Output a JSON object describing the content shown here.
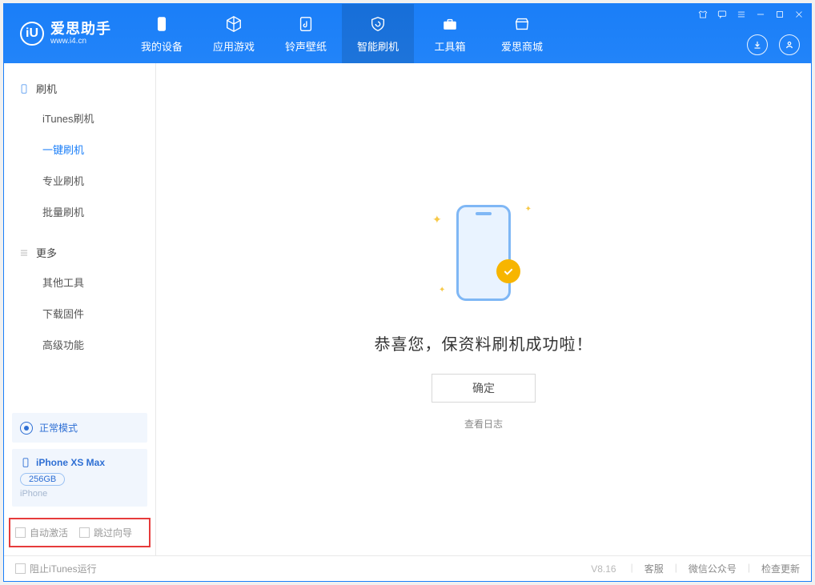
{
  "brand": {
    "title": "爱思助手",
    "sub": "www.i4.cn"
  },
  "nav": {
    "device": "我的设备",
    "apps": "应用游戏",
    "ring": "铃声壁纸",
    "flash": "智能刷机",
    "tools": "工具箱",
    "store": "爱思商城"
  },
  "sidebar": {
    "flash_head": "刷机",
    "items": {
      "itunes": "iTunes刷机",
      "onekey": "一键刷机",
      "pro": "专业刷机",
      "batch": "批量刷机"
    },
    "more_head": "更多",
    "more": {
      "other": "其他工具",
      "firmware": "下载固件",
      "advanced": "高级功能"
    },
    "status_mode": "正常模式",
    "device_name": "iPhone XS Max",
    "device_storage": "256GB",
    "device_type": "iPhone",
    "opt_activate": "自动激活",
    "opt_skip": "跳过向导"
  },
  "main": {
    "success_title": "恭喜您，保资料刷机成功啦！",
    "confirm": "确定",
    "view_log": "查看日志"
  },
  "footer": {
    "block_itunes": "阻止iTunes运行",
    "version": "V8.16",
    "support": "客服",
    "wechat": "微信公众号",
    "update": "检查更新"
  }
}
